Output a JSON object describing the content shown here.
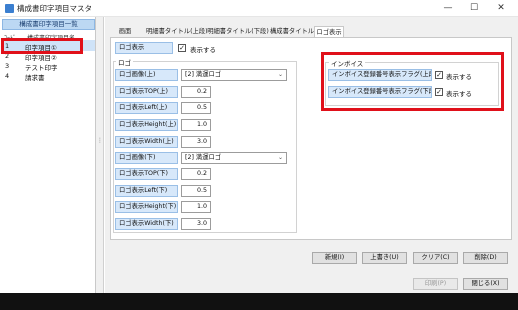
{
  "window": {
    "title": "構成書印字項目マスタ",
    "min": "—",
    "max": "☐",
    "close": "✕"
  },
  "left_panel": {
    "header": "構成書印字項目一覧",
    "col_code": "ｺｰﾄﾞ",
    "col_name": "構成書印字項目名",
    "rows": [
      {
        "code": "1",
        "name": "印字項目①"
      },
      {
        "code": "2",
        "name": "印字項目②"
      },
      {
        "code": "3",
        "name": "テスト印字"
      },
      {
        "code": "4",
        "name": "請求書"
      }
    ]
  },
  "tabs": [
    {
      "label": "画面"
    },
    {
      "label": "明細書タイトル(上段)"
    },
    {
      "label": "明細書タイトル(下段)"
    },
    {
      "label": "構成書タイトル"
    },
    {
      "label": "ロゴ表示"
    }
  ],
  "logo_display": {
    "button": "ロゴ表示",
    "check_label": "表示する",
    "checked": "✓"
  },
  "logo_group": {
    "title": "ロゴ",
    "upper_image_label": "ロゴ画像(上)",
    "upper_image_value": "[2] 満運ロゴ",
    "lower_image_label": "ロゴ画像(下)",
    "lower_image_value": "[2] 満運ロゴ",
    "chevron": "⌄",
    "fields": [
      {
        "label": "ロゴ表示TOP(上)",
        "value": "0.2"
      },
      {
        "label": "ロゴ表示Left(上)",
        "value": "0.5"
      },
      {
        "label": "ロゴ表示Height(上)",
        "value": "1.0"
      },
      {
        "label": "ロゴ表示Width(上)",
        "value": "3.0"
      },
      {
        "label": "ロゴ表示TOP(下)",
        "value": "0.2"
      },
      {
        "label": "ロゴ表示Left(下)",
        "value": "0.5"
      },
      {
        "label": "ロゴ表示Height(下)",
        "value": "1.0"
      },
      {
        "label": "ロゴ表示Width(下)",
        "value": "3.0"
      }
    ]
  },
  "invoice_group": {
    "title": "インボイス",
    "upper_label": "インボイス登録番号表示フラグ(上段)",
    "lower_label": "インボイス登録番号表示フラグ(下段)",
    "check_label": "表示する",
    "checked": "✓"
  },
  "actions": {
    "new": "新規(I)",
    "overwrite": "上書き(U)",
    "clear": "クリア(C)",
    "delete": "削除(D)",
    "print": "印刷(P)",
    "close": "閉じる(X)"
  },
  "splitter_dots": "⋮",
  "colors": {
    "highlight_red": "#e0101a",
    "label_button_bg": "#d7e8fa",
    "selected_row": "#cfe3f8"
  }
}
